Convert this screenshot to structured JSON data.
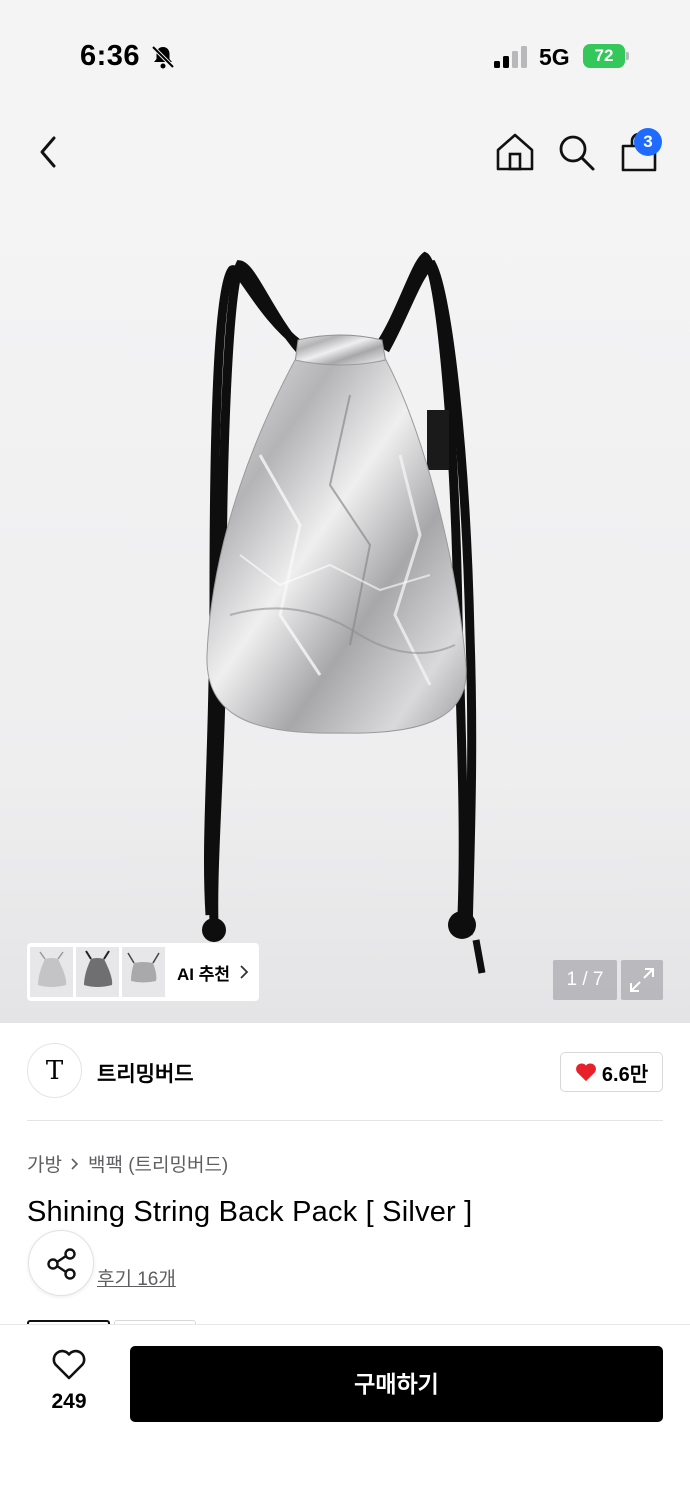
{
  "status_bar": {
    "time": "6:36",
    "network": "5G",
    "battery": "72"
  },
  "nav": {
    "cart_count": "3"
  },
  "gallery": {
    "ai_label": "AI 추천",
    "page_indicator": "1 / 7"
  },
  "brand": {
    "logo_text": "T",
    "name": "트리밍버드",
    "likes": "6.6만"
  },
  "breadcrumb": {
    "category": "가방",
    "subcategory": "백팩 (트리밍버드)"
  },
  "product": {
    "title": "Shining String Back Pack [ Silver ]",
    "reviews": "후기 16개"
  },
  "bottom_bar": {
    "wish_count": "249",
    "buy_label": "구매하기"
  },
  "colors": {
    "accent_blue": "#1f6bff",
    "heart_red": "#e8202a",
    "battery_green": "#34c759",
    "button_black": "#000000"
  }
}
